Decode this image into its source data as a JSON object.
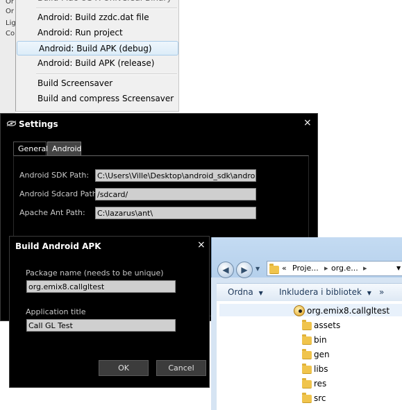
{
  "background_panel": {
    "fragments": [
      "Or",
      "Or",
      "Lig",
      "Co"
    ]
  },
  "context_menu": {
    "items": [
      {
        "label": "Build Mac OS X Universal Binary",
        "highlighted": false
      },
      {
        "label": "Android: Build zzdc.dat file",
        "highlighted": false
      },
      {
        "label": "Android: Run project",
        "highlighted": false
      },
      {
        "label": "Android: Build APK (debug)",
        "highlighted": true
      },
      {
        "label": "Android: Build APK (release)",
        "highlighted": false
      },
      {
        "label": "Build Screensaver",
        "highlighted": false
      },
      {
        "label": "Build and compress Screensaver",
        "highlighted": false
      }
    ],
    "highlight_color": "#dcecf8"
  },
  "settings_dialog": {
    "title": "Settings",
    "close_glyph": "×",
    "tabs": [
      "General",
      "Android"
    ],
    "active_tab": "Android",
    "fields": [
      {
        "label": "Android SDK Path:",
        "value": "C:\\Users\\Ville\\Desktop\\android_sdk\\android-sdk"
      },
      {
        "label": "Android Sdcard Path:",
        "value": "/sdcard/"
      },
      {
        "label": "Apache Ant Path:",
        "value": "C:\\lazarus\\ant\\"
      }
    ]
  },
  "build_dialog": {
    "title": "Build Android APK",
    "close_glyph": "×",
    "package_label": "Package name (needs to be unique)",
    "package_value": "org.emix8.callgltest",
    "app_title_label": "Application title",
    "app_title_value": "Call GL Test",
    "ok_label": "OK",
    "cancel_label": "Cancel"
  },
  "explorer": {
    "address": {
      "prefix": "«",
      "crumb1": "Proje...",
      "sep": "▸",
      "crumb2": "org.e...",
      "end": "▸"
    },
    "toolbar": {
      "organize": "Ordna",
      "include": "Inkludera i bibliotek",
      "more": "»",
      "dropdown": "▼"
    },
    "root": "org.emix8.callgltest",
    "folders": [
      "assets",
      "bin",
      "gen",
      "libs",
      "res",
      "src"
    ]
  }
}
